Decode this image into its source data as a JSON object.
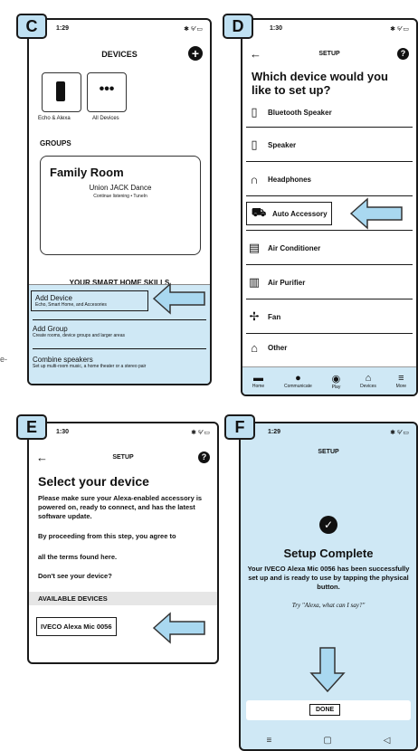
{
  "labels": {
    "c": "C",
    "d": "D",
    "e": "E",
    "f": "F"
  },
  "stray_text": "e-",
  "panelC": {
    "status_time": "1:29",
    "status_right": "✱ ⁵⁄ ▭",
    "title": "DEVICES",
    "tiles": [
      {
        "label": "Echo & Alexa"
      },
      {
        "label": "All Devices"
      }
    ],
    "groups_heading": "GROUPS",
    "family_room": {
      "title": "Family Room",
      "now_playing": "Union JACK Dance",
      "status": "Continue listening • TuneIn"
    },
    "skills_heading": "YOUR SMART HOME SKILLS",
    "menu": [
      {
        "title": "Add Device",
        "subtitle": "Echo, Smart Home, and Accesories"
      },
      {
        "title": "Add Group",
        "subtitle": "Create rooms, device groups and larger areas"
      },
      {
        "title": "Combine speakers",
        "subtitle": "Set up multi-room music, a home theater or a stereo pair"
      }
    ]
  },
  "panelD": {
    "status_time": "1:30",
    "status_right": "✱ ⁵⁄ ▭",
    "back": "←",
    "title": "SETUP",
    "help": "?",
    "heading": "Which device would you like to set up?",
    "devices": [
      {
        "label": "Bluetooth Speaker",
        "icon": "speaker-icon"
      },
      {
        "label": "Speaker",
        "icon": "speaker-icon"
      },
      {
        "label": "Headphones",
        "icon": "headphones-icon"
      },
      {
        "label": "Auto Accessory",
        "icon": "car-icon"
      },
      {
        "label": "Air Conditioner",
        "icon": "ac-icon"
      },
      {
        "label": "Air Purifier",
        "icon": "purifier-icon"
      },
      {
        "label": "Fan",
        "icon": "fan-icon"
      },
      {
        "label": "Other",
        "icon": "other-icon"
      }
    ],
    "nav": [
      {
        "label": "Home"
      },
      {
        "label": "Communicate"
      },
      {
        "label": "Play"
      },
      {
        "label": "Devices"
      },
      {
        "label": "More"
      }
    ]
  },
  "panelE": {
    "status_time": "1:30",
    "status_right": "✱ ⁵⁄ ▭",
    "back": "←",
    "title": "SETUP",
    "help": "?",
    "heading": "Select your device",
    "p1": "Please make sure your Alexa-enabled accessory is powered on, ready to connect, and has the latest software update.",
    "p2": "By proceeding from this step, you agree to",
    "p3": "all the terms found here.",
    "p4": "Don't see your device?",
    "available": "AVAILABLE DEVICES",
    "device": "IVECO Alexa Mic 0056"
  },
  "panelF": {
    "status_time": "1:29",
    "status_right": "✱ ⁵⁄ ▭",
    "title": "SETUP",
    "heading": "Setup Complete",
    "message": "Your IVECO Alexa Mic 0056 has been successfully set up and is ready to use by tapping the physical button.",
    "try": "Try \"Alexa, what can I say?\"",
    "done": "DONE",
    "android_nav": [
      "≡",
      "▢",
      "◁"
    ]
  }
}
